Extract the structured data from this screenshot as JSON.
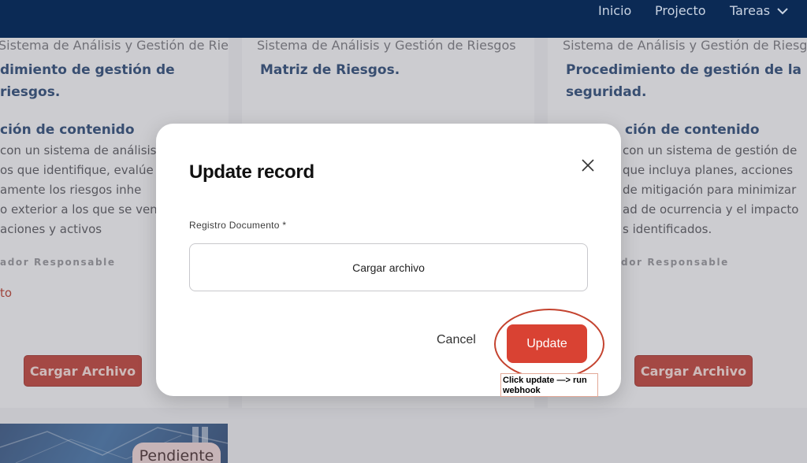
{
  "nav": {
    "items": [
      "Inicio",
      "Projecto",
      "Tareas"
    ]
  },
  "cards": [
    {
      "subtitle": "Sistema de Análisis y Gestión de Riesgos",
      "title_lines": [
        "dimiento de gestión de riesgos."
      ],
      "section_heading": "ción de contenido",
      "body_lines": [
        "con un sistema de análisis",
        "os que identifique, evalúe y",
        "amente los riesgos inhe",
        "o exterior a los que se ven",
        "aciones y activos"
      ],
      "responsable": "ador Responsable",
      "red_fragment": "to",
      "button_label": "Cargar Archivo"
    },
    {
      "subtitle": "Sistema de Análisis y Gestión de Riesgos",
      "title_lines": [
        "Matriz de Riesgos."
      ]
    },
    {
      "subtitle": "Sistema de Análisis y Gestión de Riesgos",
      "title_lines": [
        "Procedimiento de gestión de la",
        "seguridad."
      ],
      "section_heading": "ción de contenido",
      "body_lines": [
        "con un sistema de gestión de",
        "que incluya planes, acciones",
        "de mitigación para minimizar",
        "ad de ocurrencia y el impacto",
        "s identificados."
      ],
      "responsable": "dor Responsable",
      "button_label": "Cargar Archivo"
    }
  ],
  "status_badge": "Pendiente",
  "modal": {
    "title": "Update record",
    "field_label": "Registro Documento *",
    "upload_label": "Cargar archivo",
    "cancel_label": "Cancel",
    "update_label": "Update"
  },
  "annotation": {
    "text": "Click update —> run webhook",
    "color": "#c4432f"
  },
  "colors": {
    "nav_bg": "#0b2a55",
    "accent_red": "#d94233",
    "title_blue": "#1e3d6b"
  },
  "icons": {
    "close": "close-icon",
    "tareas_dropdown": "chevron-down-icon"
  }
}
